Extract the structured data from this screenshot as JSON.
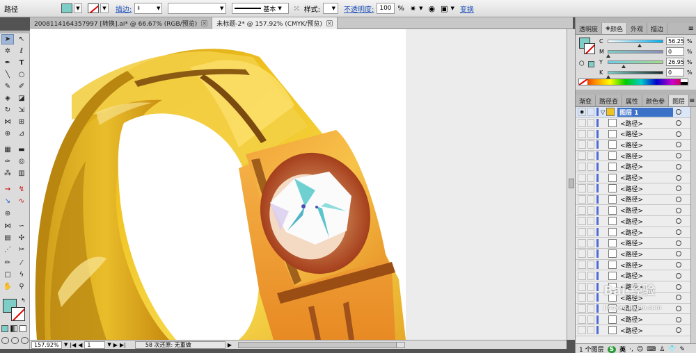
{
  "control_bar": {
    "object_type": "路径",
    "stroke_label": "描边:",
    "stroke_weight": "",
    "stroke_profile": "基本",
    "style_label": "样式:",
    "opacity_label": "不透明度:",
    "opacity_value": "100",
    "opacity_unit": "%",
    "transform_label": "变换",
    "fill_color": "#7ecdc6"
  },
  "tabs": [
    {
      "label": "2008114164357997 [转换].ai* @ 66.67% (RGB/预览)",
      "active": false
    },
    {
      "label": "未标题-2* @ 157.92% (CMYK/预览)",
      "active": true
    }
  ],
  "status_bar": {
    "zoom": "157.92%",
    "page": "1",
    "status_text": "58 次还原: 无重做"
  },
  "color_panel": {
    "tabs": [
      "透明度",
      "颜色",
      "外观",
      "描边"
    ],
    "active_tab": "颜色",
    "channels": [
      {
        "name": "C",
        "value": "56.25",
        "pct": 56.25
      },
      {
        "name": "M",
        "value": "0",
        "pct": 0
      },
      {
        "name": "Y",
        "value": "26.95",
        "pct": 26.95
      },
      {
        "name": "K",
        "value": "0",
        "pct": 0
      }
    ],
    "unit": "%"
  },
  "layers_panel": {
    "tabs": [
      "渐变",
      "路径查",
      "属性",
      "颜色参",
      "图层"
    ],
    "active_tab": "图层",
    "layer_name": "图层 1",
    "items": [
      "<路径>",
      "<路径>",
      "<路径>",
      "<路径>",
      "<路径>",
      "<路径>",
      "<路径>",
      "<路径>",
      "<路径>",
      "<路径>",
      "<路径>",
      "<路径>",
      "<路径>",
      "<路径>",
      "<路径>",
      "<路径>",
      "<路径>",
      "<路径>",
      "<路径>",
      "<路径>"
    ],
    "footer_text": "1 个图层",
    "ime_label": "英"
  },
  "watermark_text": "Bai 经验",
  "watermark_url": "jingyan.baidu.com"
}
